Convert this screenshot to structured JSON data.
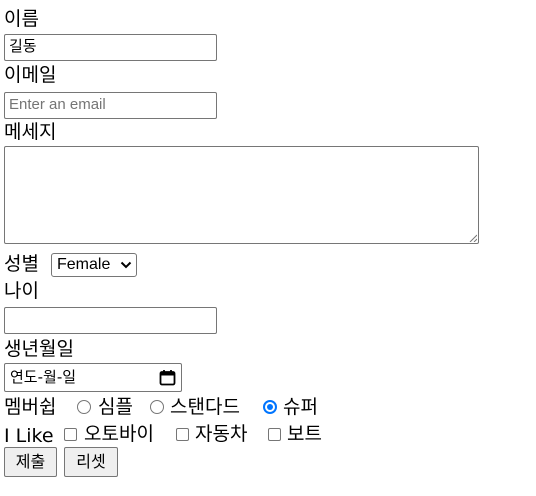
{
  "form": {
    "name_label": "이름",
    "name_value": "길동",
    "email_label": "이메일",
    "email_placeholder": "Enter an email",
    "message_label": "메세지",
    "message_value": "",
    "gender_label": "성별",
    "gender_selected": "Female",
    "age_label": "나이",
    "age_value": "",
    "birthdate_label": "생년월일",
    "birthdate_placeholder": "연도-월-일",
    "membership_label": "멤버쉽",
    "membership_options": [
      {
        "label": "심플",
        "checked": false
      },
      {
        "label": "스탠다드",
        "checked": false
      },
      {
        "label": "슈퍼",
        "checked": true
      }
    ],
    "like_label": "I Like",
    "like_options": [
      {
        "label": "오토바이",
        "checked": false
      },
      {
        "label": "자동차",
        "checked": false
      },
      {
        "label": "보트",
        "checked": false
      }
    ],
    "submit_label": "제출",
    "reset_label": "리셋"
  },
  "icons": {
    "select": "chevron-down-icon",
    "date": "calendar-icon",
    "textarea": "resize-grip-icon"
  },
  "colors": {
    "accent": "#0075ff",
    "border": "#767676",
    "button_bg": "#efefef",
    "placeholder": "#757575"
  }
}
